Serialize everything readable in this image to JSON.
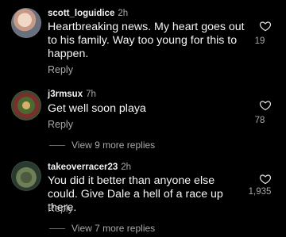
{
  "comments": [
    {
      "username": "scott_loguidice",
      "time": "2h",
      "text": "Heartbreaking news. My heart goes out to his family. Way too young for this to happen.",
      "reply_label": "Reply",
      "likes": "19"
    },
    {
      "username": "j3rmsux",
      "time": "7h",
      "text": "Get well soon playa",
      "reply_label": "Reply",
      "likes": "78",
      "view_replies": "View 9 more replies"
    },
    {
      "username": "takeoverracer23",
      "time": "2h",
      "text": "You did it better than anyone else could. Give Dale a hell of a race up there.",
      "reply_label": "Reply",
      "likes": "1,935",
      "view_replies": "View 7 more replies"
    }
  ],
  "colors": {
    "background": "#000000",
    "text": "#f5f5f5",
    "muted": "#a8a8a8"
  },
  "icons": {
    "like": "heart-outline-icon"
  }
}
